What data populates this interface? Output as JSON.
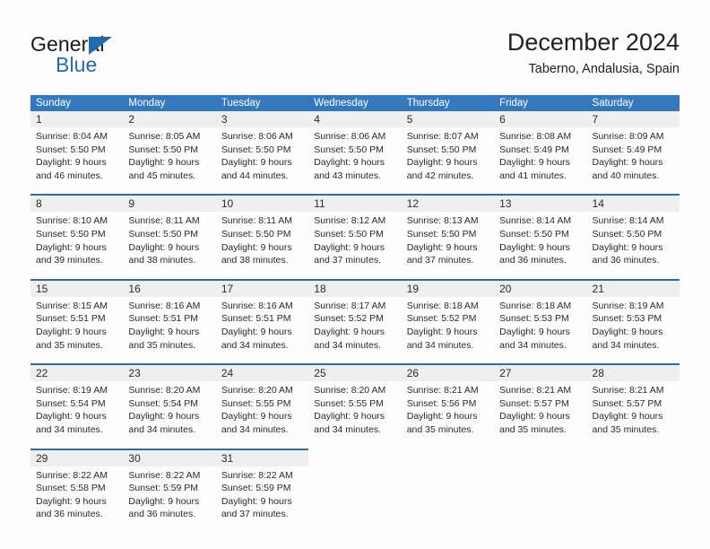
{
  "logo": {
    "word_one": "General",
    "word_two": "Blue",
    "triangle_icon": "triangle-icon",
    "brand_blue": "#1f6cb0"
  },
  "header": {
    "title": "December 2024",
    "location": "Taberno, Andalusia, Spain"
  },
  "theme": {
    "header_blue": "#3479bd",
    "separator_blue": "#2e6da4",
    "daynum_band": "#efefef",
    "page_background": "#fdfdfd",
    "text": "#2a2a2a"
  },
  "calendar": {
    "weekday_headers": [
      "Sunday",
      "Monday",
      "Tuesday",
      "Wednesday",
      "Thursday",
      "Friday",
      "Saturday"
    ],
    "weeks": [
      [
        {
          "day": "1",
          "sunrise": "Sunrise: 8:04 AM",
          "sunset": "Sunset: 5:50 PM",
          "daylight_1": "Daylight: 9 hours",
          "daylight_2": "and 46 minutes."
        },
        {
          "day": "2",
          "sunrise": "Sunrise: 8:05 AM",
          "sunset": "Sunset: 5:50 PM",
          "daylight_1": "Daylight: 9 hours",
          "daylight_2": "and 45 minutes."
        },
        {
          "day": "3",
          "sunrise": "Sunrise: 8:06 AM",
          "sunset": "Sunset: 5:50 PM",
          "daylight_1": "Daylight: 9 hours",
          "daylight_2": "and 44 minutes."
        },
        {
          "day": "4",
          "sunrise": "Sunrise: 8:06 AM",
          "sunset": "Sunset: 5:50 PM",
          "daylight_1": "Daylight: 9 hours",
          "daylight_2": "and 43 minutes."
        },
        {
          "day": "5",
          "sunrise": "Sunrise: 8:07 AM",
          "sunset": "Sunset: 5:50 PM",
          "daylight_1": "Daylight: 9 hours",
          "daylight_2": "and 42 minutes."
        },
        {
          "day": "6",
          "sunrise": "Sunrise: 8:08 AM",
          "sunset": "Sunset: 5:49 PM",
          "daylight_1": "Daylight: 9 hours",
          "daylight_2": "and 41 minutes."
        },
        {
          "day": "7",
          "sunrise": "Sunrise: 8:09 AM",
          "sunset": "Sunset: 5:49 PM",
          "daylight_1": "Daylight: 9 hours",
          "daylight_2": "and 40 minutes."
        }
      ],
      [
        {
          "day": "8",
          "sunrise": "Sunrise: 8:10 AM",
          "sunset": "Sunset: 5:50 PM",
          "daylight_1": "Daylight: 9 hours",
          "daylight_2": "and 39 minutes."
        },
        {
          "day": "9",
          "sunrise": "Sunrise: 8:11 AM",
          "sunset": "Sunset: 5:50 PM",
          "daylight_1": "Daylight: 9 hours",
          "daylight_2": "and 38 minutes."
        },
        {
          "day": "10",
          "sunrise": "Sunrise: 8:11 AM",
          "sunset": "Sunset: 5:50 PM",
          "daylight_1": "Daylight: 9 hours",
          "daylight_2": "and 38 minutes."
        },
        {
          "day": "11",
          "sunrise": "Sunrise: 8:12 AM",
          "sunset": "Sunset: 5:50 PM",
          "daylight_1": "Daylight: 9 hours",
          "daylight_2": "and 37 minutes."
        },
        {
          "day": "12",
          "sunrise": "Sunrise: 8:13 AM",
          "sunset": "Sunset: 5:50 PM",
          "daylight_1": "Daylight: 9 hours",
          "daylight_2": "and 37 minutes."
        },
        {
          "day": "13",
          "sunrise": "Sunrise: 8:14 AM",
          "sunset": "Sunset: 5:50 PM",
          "daylight_1": "Daylight: 9 hours",
          "daylight_2": "and 36 minutes."
        },
        {
          "day": "14",
          "sunrise": "Sunrise: 8:14 AM",
          "sunset": "Sunset: 5:50 PM",
          "daylight_1": "Daylight: 9 hours",
          "daylight_2": "and 36 minutes."
        }
      ],
      [
        {
          "day": "15",
          "sunrise": "Sunrise: 8:15 AM",
          "sunset": "Sunset: 5:51 PM",
          "daylight_1": "Daylight: 9 hours",
          "daylight_2": "and 35 minutes."
        },
        {
          "day": "16",
          "sunrise": "Sunrise: 8:16 AM",
          "sunset": "Sunset: 5:51 PM",
          "daylight_1": "Daylight: 9 hours",
          "daylight_2": "and 35 minutes."
        },
        {
          "day": "17",
          "sunrise": "Sunrise: 8:16 AM",
          "sunset": "Sunset: 5:51 PM",
          "daylight_1": "Daylight: 9 hours",
          "daylight_2": "and 34 minutes."
        },
        {
          "day": "18",
          "sunrise": "Sunrise: 8:17 AM",
          "sunset": "Sunset: 5:52 PM",
          "daylight_1": "Daylight: 9 hours",
          "daylight_2": "and 34 minutes."
        },
        {
          "day": "19",
          "sunrise": "Sunrise: 8:18 AM",
          "sunset": "Sunset: 5:52 PM",
          "daylight_1": "Daylight: 9 hours",
          "daylight_2": "and 34 minutes."
        },
        {
          "day": "20",
          "sunrise": "Sunrise: 8:18 AM",
          "sunset": "Sunset: 5:53 PM",
          "daylight_1": "Daylight: 9 hours",
          "daylight_2": "and 34 minutes."
        },
        {
          "day": "21",
          "sunrise": "Sunrise: 8:19 AM",
          "sunset": "Sunset: 5:53 PM",
          "daylight_1": "Daylight: 9 hours",
          "daylight_2": "and 34 minutes."
        }
      ],
      [
        {
          "day": "22",
          "sunrise": "Sunrise: 8:19 AM",
          "sunset": "Sunset: 5:54 PM",
          "daylight_1": "Daylight: 9 hours",
          "daylight_2": "and 34 minutes."
        },
        {
          "day": "23",
          "sunrise": "Sunrise: 8:20 AM",
          "sunset": "Sunset: 5:54 PM",
          "daylight_1": "Daylight: 9 hours",
          "daylight_2": "and 34 minutes."
        },
        {
          "day": "24",
          "sunrise": "Sunrise: 8:20 AM",
          "sunset": "Sunset: 5:55 PM",
          "daylight_1": "Daylight: 9 hours",
          "daylight_2": "and 34 minutes."
        },
        {
          "day": "25",
          "sunrise": "Sunrise: 8:20 AM",
          "sunset": "Sunset: 5:55 PM",
          "daylight_1": "Daylight: 9 hours",
          "daylight_2": "and 34 minutes."
        },
        {
          "day": "26",
          "sunrise": "Sunrise: 8:21 AM",
          "sunset": "Sunset: 5:56 PM",
          "daylight_1": "Daylight: 9 hours",
          "daylight_2": "and 35 minutes."
        },
        {
          "day": "27",
          "sunrise": "Sunrise: 8:21 AM",
          "sunset": "Sunset: 5:57 PM",
          "daylight_1": "Daylight: 9 hours",
          "daylight_2": "and 35 minutes."
        },
        {
          "day": "28",
          "sunrise": "Sunrise: 8:21 AM",
          "sunset": "Sunset: 5:57 PM",
          "daylight_1": "Daylight: 9 hours",
          "daylight_2": "and 35 minutes."
        }
      ],
      [
        {
          "day": "29",
          "sunrise": "Sunrise: 8:22 AM",
          "sunset": "Sunset: 5:58 PM",
          "daylight_1": "Daylight: 9 hours",
          "daylight_2": "and 36 minutes."
        },
        {
          "day": "30",
          "sunrise": "Sunrise: 8:22 AM",
          "sunset": "Sunset: 5:59 PM",
          "daylight_1": "Daylight: 9 hours",
          "daylight_2": "and 36 minutes."
        },
        {
          "day": "31",
          "sunrise": "Sunrise: 8:22 AM",
          "sunset": "Sunset: 5:59 PM",
          "daylight_1": "Daylight: 9 hours",
          "daylight_2": "and 37 minutes."
        },
        {
          "day": "",
          "sunrise": "",
          "sunset": "",
          "daylight_1": "",
          "daylight_2": ""
        },
        {
          "day": "",
          "sunrise": "",
          "sunset": "",
          "daylight_1": "",
          "daylight_2": ""
        },
        {
          "day": "",
          "sunrise": "",
          "sunset": "",
          "daylight_1": "",
          "daylight_2": ""
        },
        {
          "day": "",
          "sunrise": "",
          "sunset": "",
          "daylight_1": "",
          "daylight_2": ""
        }
      ]
    ]
  }
}
